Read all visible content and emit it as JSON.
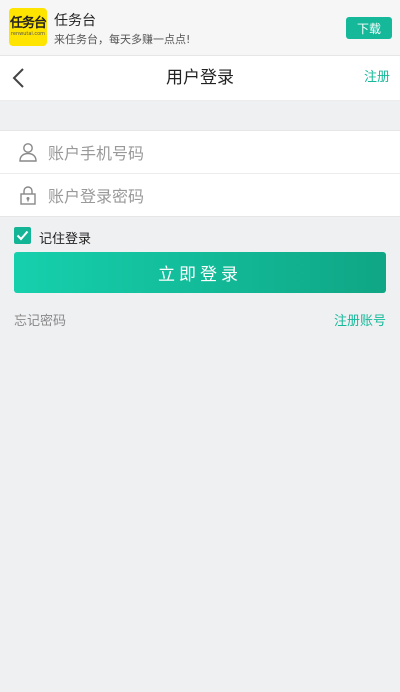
{
  "banner": {
    "logo_text": "任务台",
    "logo_subtext": "renwutai.com",
    "app_name": "任务台",
    "app_desc": "来任务台，每天多赚一点点!",
    "download_label": "下载"
  },
  "header": {
    "title": "用户登录",
    "register_label": "注册"
  },
  "form": {
    "account_placeholder": "账户手机号码",
    "password_placeholder": "账户登录密码"
  },
  "remember": {
    "label": "记住登录",
    "checked": true
  },
  "login_button_label": "立即登录",
  "links": {
    "forgot_password": "忘记密码",
    "register_account": "注册账号"
  },
  "colors": {
    "accent": "#15b99a",
    "button_gradient_start": "#16d0ad",
    "button_gradient_end": "#0fa685",
    "logo_yellow": "#ffe400",
    "background": "#eff0f2"
  },
  "icons": [
    "back-arrow-icon",
    "user-icon",
    "lock-icon",
    "checkmark-icon"
  ]
}
